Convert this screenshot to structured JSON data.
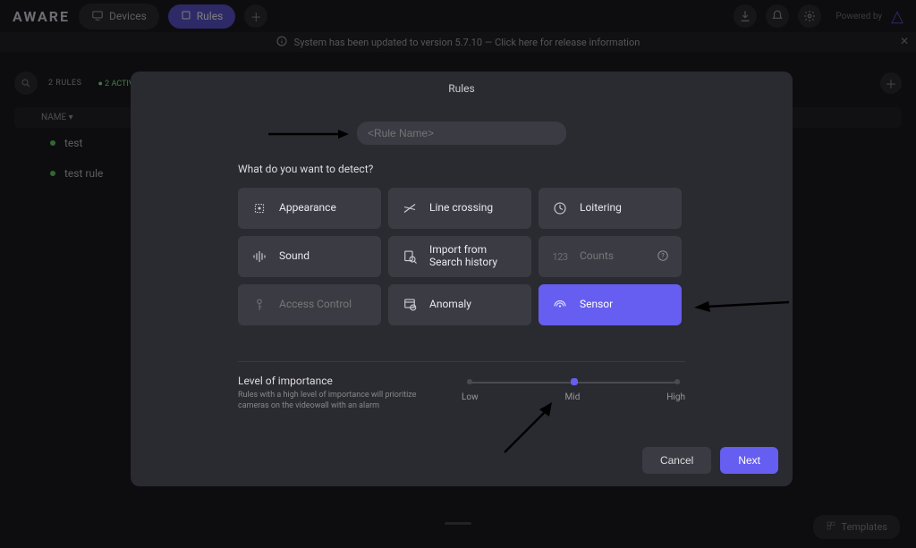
{
  "brand": "AWARE",
  "nav": {
    "devices": "Devices",
    "rules": "Rules"
  },
  "powered_by": "Powered by",
  "banner": {
    "text": "System has been updated to version 5.7.10 — Click here for release information"
  },
  "list": {
    "count_label": "2 RULES",
    "active_label": "2 ACTIVE",
    "col_name": "NAME",
    "rows": [
      "test",
      "test rule"
    ]
  },
  "modal": {
    "title": "Rules",
    "rule_name_placeholder": "<Rule Name>",
    "detect_question": "What do you want to detect?",
    "tiles": {
      "appearance": "Appearance",
      "line_crossing": "Line crossing",
      "loitering": "Loitering",
      "sound": "Sound",
      "import_search": "Import from Search history",
      "counts": "Counts",
      "access": "Access Control",
      "anomaly": "Anomaly",
      "sensor": "Sensor"
    },
    "importance": {
      "title": "Level of importance",
      "desc": "Rules with a high level of importance will prioritize cameras on the videowall with an alarm",
      "low": "Low",
      "mid": "Mid",
      "high": "High",
      "selected": "Mid"
    },
    "buttons": {
      "cancel": "Cancel",
      "next": "Next"
    }
  },
  "templates_label": "Templates"
}
